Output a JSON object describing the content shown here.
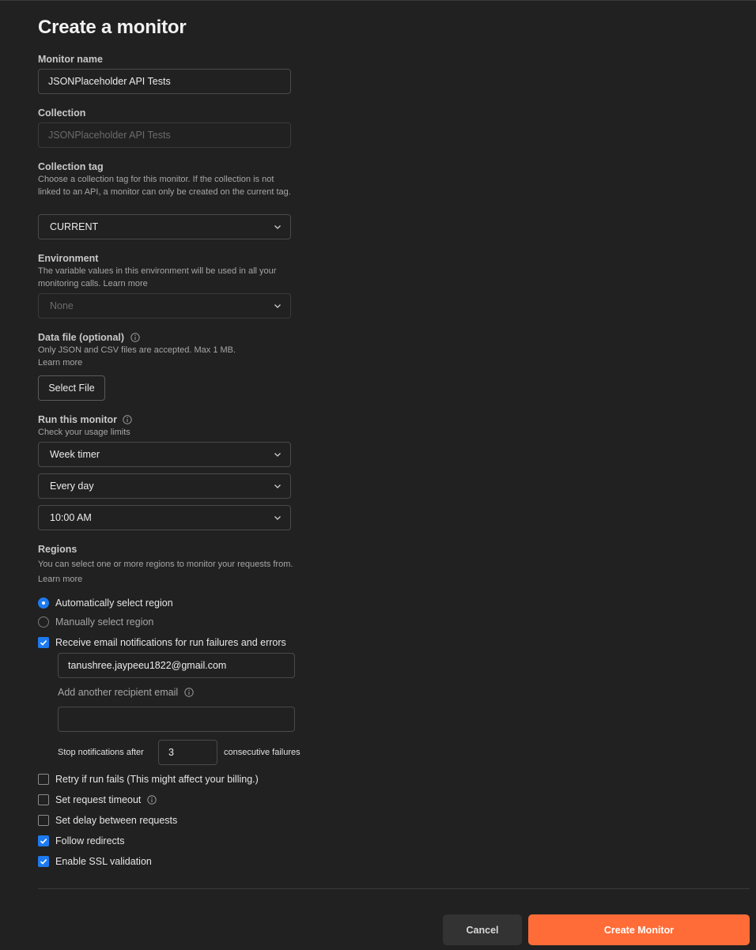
{
  "page": {
    "title": "Create a monitor"
  },
  "monitor_name": {
    "label": "Monitor name",
    "value": "JSONPlaceholder API Tests"
  },
  "collection": {
    "label": "Collection",
    "value": "JSONPlaceholder API Tests"
  },
  "collection_tag": {
    "label": "Collection tag",
    "help": "Choose a collection tag for this monitor. If the collection is not linked to an API, a monitor can only be created on the current tag.",
    "selected": "CURRENT"
  },
  "environment": {
    "label": "Environment",
    "help": "The variable values in this environment will be used in all your monitoring calls. Learn more",
    "selected": "None"
  },
  "data_file": {
    "label": "Data file (optional)",
    "help_line1": "Only JSON and CSV files are accepted. Max 1 MB.",
    "help_line2": "Learn more",
    "button": "Select File"
  },
  "schedule": {
    "label": "Run this monitor",
    "help": "Check your usage limits",
    "timer": "Week timer",
    "frequency": "Every day",
    "time": "10:00 AM"
  },
  "regions": {
    "label": "Regions",
    "help": "You can select one or more regions to monitor your requests from. Learn more",
    "auto": "Automatically select region",
    "manual": "Manually select region"
  },
  "notifications": {
    "label": "Receive email notifications for run failures and errors",
    "email": "tanushree.jaypeeu1822@gmail.com",
    "add_label": "Add another recipient email",
    "add_value": "",
    "stop_prefix": "Stop notifications after",
    "stop_count": "3",
    "stop_suffix": "consecutive failures"
  },
  "options": {
    "retry": "Retry if run fails (This might affect your billing.)",
    "timeout": "Set request timeout",
    "delay": "Set delay between requests",
    "redirects": "Follow redirects",
    "ssl": "Enable SSL validation"
  },
  "footer": {
    "cancel": "Cancel",
    "create": "Create Monitor"
  },
  "colors": {
    "accent": "#ff6c37",
    "check": "#1d7af0",
    "background": "#212121"
  }
}
